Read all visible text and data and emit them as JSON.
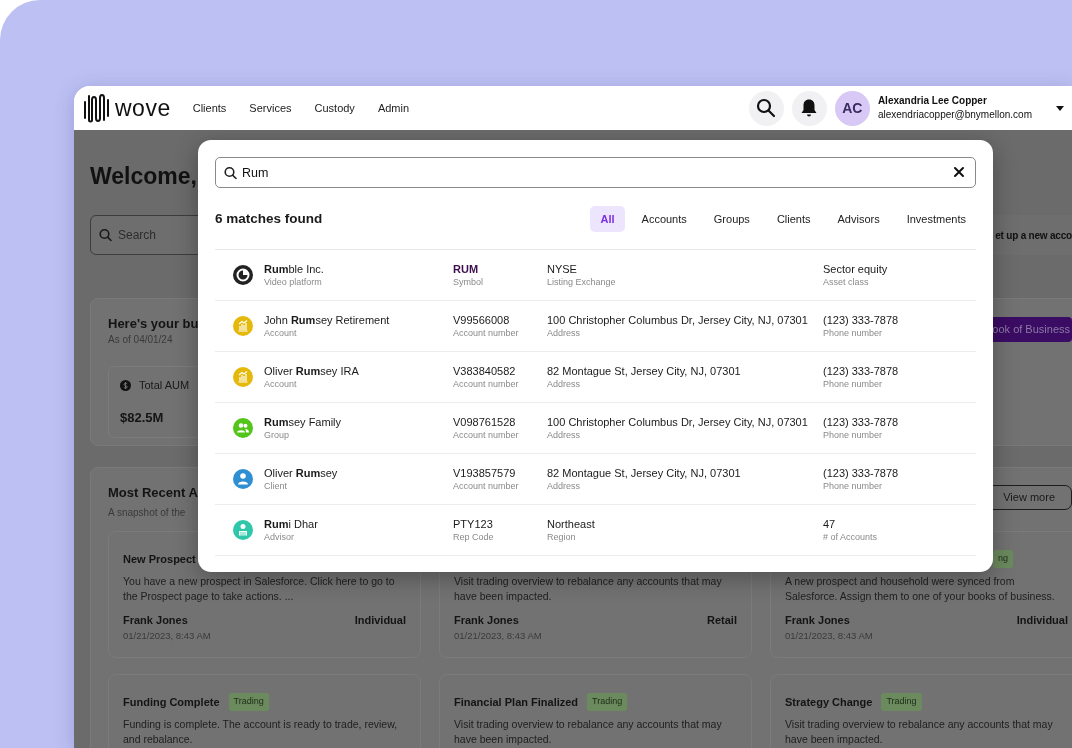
{
  "navbar": {
    "logo": "wove",
    "links": [
      {
        "label": "Clients"
      },
      {
        "label": "Services"
      },
      {
        "label": "Custody"
      },
      {
        "label": "Admin"
      }
    ],
    "user": {
      "initials": "AC",
      "name": "Alexandria Lee Copper",
      "email": "alexendriacopper@bnymellon.com"
    }
  },
  "dashboard": {
    "greeting": "Welcome,",
    "search": {
      "placeholder": "Search"
    },
    "setup_button": "et up a new acco",
    "business": {
      "title": "Here's your bu",
      "as_of": "As of 04/01/24",
      "metric": {
        "label": "Total AUM",
        "value": "$82.5M"
      },
      "button": "ook of Business"
    },
    "activity": {
      "title": "Most Recent A",
      "subtitle": "A snapshot of the",
      "view_more": "View more",
      "cards": [
        {
          "title": "New Prospect",
          "text": "You have a new prospect in Salesforce. Click here to go to the Prospect page to take actions. ...",
          "person": "Frank Jones",
          "segment": "Individual",
          "date": "01/21/2023, 8:43 AM"
        },
        {
          "text": "Visit trading overview to rebalance any accounts that may have been impacted.",
          "person": "Frank Jones",
          "segment": "Retail",
          "date": "01/21/2023, 8:43 AM"
        },
        {
          "tag": "ng",
          "text": "A new prospect and household were synced from Salesforce. Assign them to one of your books of business.",
          "person": "Frank Jones",
          "segment": "Individual",
          "date": "01/21/2023, 8:43 AM"
        },
        {
          "title": "Funding Complete",
          "tag": "Trading",
          "text": "Funding is complete. The account is ready to trade, review, and rebalance."
        },
        {
          "title": "Financial Plan Finalized",
          "tag": "Trading",
          "text": "Visit trading overview to rebalance any accounts that may have been impacted."
        },
        {
          "title": "Strategy Change",
          "tag": "Trading",
          "text": "Visit trading overview to rebalance any accounts that may have been impacted."
        }
      ]
    }
  },
  "search_modal": {
    "query": "Rum",
    "matches": "6 matches found",
    "filters": [
      {
        "label": "All",
        "selected": true
      },
      {
        "label": "Accounts",
        "selected": false
      },
      {
        "label": "Groups",
        "selected": false
      },
      {
        "label": "Clients",
        "selected": false
      },
      {
        "label": "Advisors",
        "selected": false
      },
      {
        "label": "Investments",
        "selected": false
      }
    ],
    "results": [
      {
        "kind": "investment",
        "name": "**Rum**ble Inc.",
        "type": "Video platform",
        "fields": [
          {
            "value": "RUM",
            "label": "Symbol",
            "highlighted": true
          },
          {
            "value": "NYSE",
            "label": "Listing Exchange"
          },
          {
            "value": "Sector equity",
            "label": "Asset class"
          }
        ]
      },
      {
        "kind": "account",
        "name": "John **Rum**sey Retirement",
        "type": "Account",
        "fields": [
          {
            "value": "V99566008",
            "label": "Account number",
            "highlighted": false
          },
          {
            "value": "100 Christopher Columbus Dr, Jersey City, NJ, 07301",
            "label": "Address"
          },
          {
            "value": "(123) 333-7878",
            "label": "Phone number"
          }
        ]
      },
      {
        "kind": "account",
        "name": "Oliver **Rum**sey IRA",
        "type": "Account",
        "fields": [
          {
            "value": "V383840582",
            "label": "Account number",
            "highlighted": false
          },
          {
            "value": "82 Montague St, Jersey City, NJ, 07301",
            "label": "Address"
          },
          {
            "value": "(123) 333-7878",
            "label": "Phone number"
          }
        ]
      },
      {
        "kind": "group",
        "name": "**Rum**sey Family",
        "type": "Group",
        "fields": [
          {
            "value": "V098761528",
            "label": "Account number",
            "highlighted": false
          },
          {
            "value": "100 Christopher Columbus Dr, Jersey City, NJ, 07301",
            "label": "Address"
          },
          {
            "value": "(123) 333-7878",
            "label": "Phone number"
          }
        ]
      },
      {
        "kind": "client",
        "name": "Oliver **Rum**sey",
        "type": "Client",
        "fields": [
          {
            "value": "V193857579",
            "label": "Account number",
            "highlighted": false
          },
          {
            "value": "82 Montague St, Jersey City, NJ, 07301",
            "label": "Address"
          },
          {
            "value": "(123) 333-7878",
            "label": "Phone number"
          }
        ]
      },
      {
        "kind": "advisor",
        "name": "**Rum**i Dhar",
        "type": "Advisor",
        "fields": [
          {
            "value": "PTY123",
            "label": "Rep Code",
            "highlighted": false
          },
          {
            "value": "Northeast",
            "label": "Region"
          },
          {
            "value": "47",
            "label": "# of Accounts"
          }
        ]
      }
    ]
  }
}
